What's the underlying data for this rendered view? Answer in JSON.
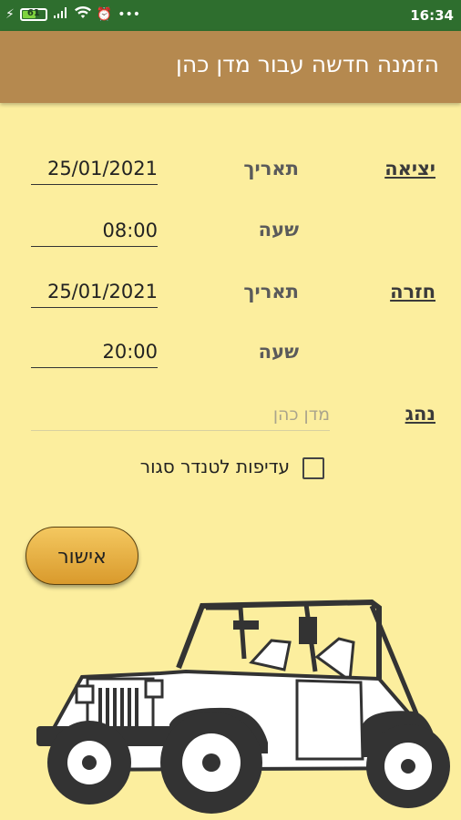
{
  "status_bar": {
    "battery": "61",
    "signal": "lte",
    "time": "16:34"
  },
  "app_bar": {
    "title": "הזמנה חדשה עבור מדן כהן"
  },
  "departure": {
    "section_label": "יציאה",
    "date_label": "תאריך",
    "date_value": "25/01/2021",
    "time_label": "שעה",
    "time_value": "08:00"
  },
  "return": {
    "section_label": "חזרה",
    "date_label": "תאריך",
    "date_value": "25/01/2021",
    "time_label": "שעה",
    "time_value": "20:00"
  },
  "driver": {
    "section_label": "נהג",
    "placeholder": "מדן כהן"
  },
  "preference": {
    "label": "עדיפות לטנדר סגור",
    "checked": false
  },
  "confirm_button": {
    "label": "אישור"
  },
  "colors": {
    "status_bar": "#2e6e2e",
    "app_bar": "#b5894f",
    "background": "#fcee9e",
    "button": "#e3a83a"
  }
}
